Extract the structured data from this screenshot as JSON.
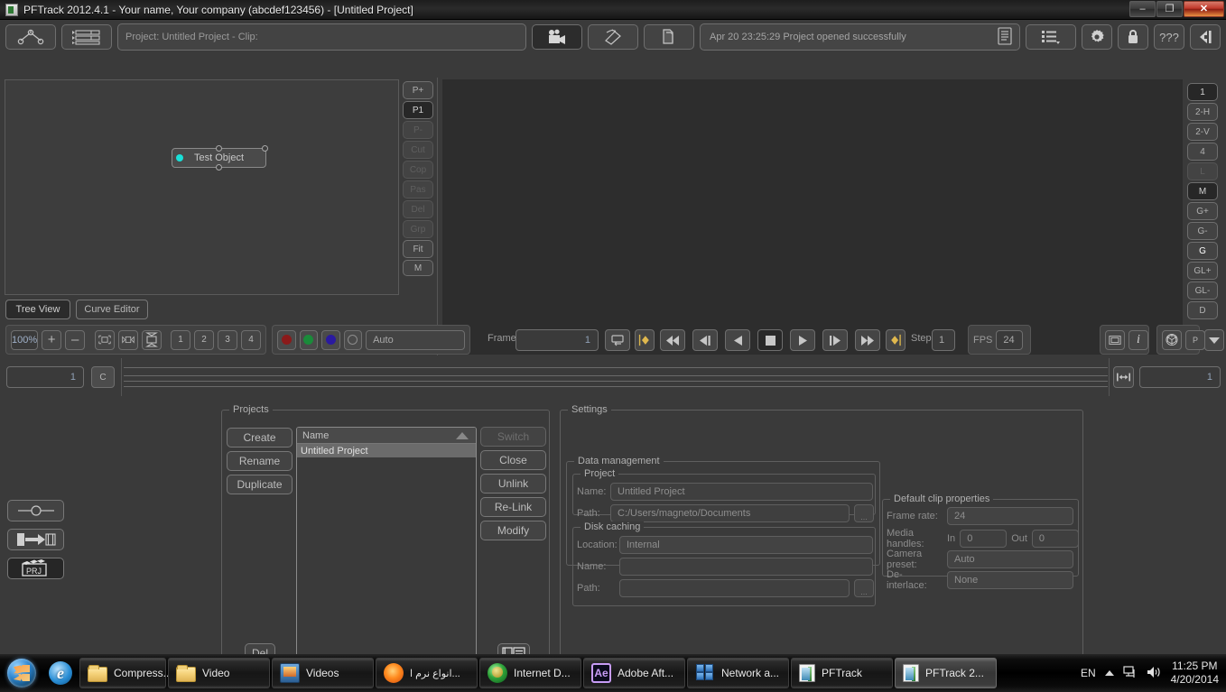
{
  "titlebar": {
    "title": "PFTrack 2012.4.1 - Your name, Your company (abcdef123456) - [Untitled Project]",
    "minimize": "–",
    "restore": "❐",
    "close": "✕"
  },
  "toolbar": {
    "project_field": "Project: Untitled Project - Clip:",
    "status_message": "Apr 20 23:25:29 Project opened successfully",
    "buttons": {
      "tree_icon": "node-tree-icon",
      "list_icon": "list-rows-icon",
      "camera_icon": "camera-icon",
      "film_icon": "film-clip-icon",
      "file_icon": "file-copy-icon",
      "log_icon": "log-text-icon",
      "menu_icon": "list-menu-icon",
      "gear_icon": "gear-icon",
      "lock_icon": "lock-icon",
      "help_label": "???",
      "exit_icon": "exit-icon"
    }
  },
  "node_editor": {
    "node_label": "Test Object",
    "left_tools": [
      "P+",
      "P1",
      "P-",
      "Cut",
      "Cop",
      "Pas",
      "Del",
      "Grp",
      "Fit",
      "M"
    ],
    "tabs": [
      {
        "label": "Tree View",
        "active": true
      },
      {
        "label": "Curve Editor",
        "active": false
      }
    ]
  },
  "clip_view": {
    "right_tools": [
      "1",
      "2-H",
      "2-V",
      "4",
      "L",
      "M",
      "G+",
      "G-",
      "G",
      "GL+",
      "GL-",
      "D"
    ]
  },
  "controls": {
    "zoom_value": "100%",
    "zoom_in": "+",
    "zoom_out": "–",
    "fit_icon": "fit-frame-icon",
    "fit_width_icon": "fit-width-icon",
    "fit_height_icon": "fit-height-icon",
    "view_numbers": [
      "1",
      "2",
      "3",
      "4"
    ],
    "channels": [
      "#8b1a1a",
      "#1a8b3a",
      "#2a1aa0"
    ],
    "channel_alpha_icon": "alpha-channel-icon",
    "lut_value": "Auto",
    "frame_label": "Frame",
    "frame_value": "1",
    "loop_icon": "loop-icon",
    "key_left_icon": "key-start-icon",
    "key_right_icon": "key-end-icon",
    "transport": [
      "rewind-all",
      "step-back-fast",
      "step-back",
      "stop",
      "play",
      "step-forward",
      "forward-all"
    ],
    "step_label": "Step",
    "step_value": "1",
    "fps_label": "FPS",
    "fps_value": "24",
    "monitor_icon": "film-strip-icon",
    "info_icon": "info-icon",
    "cube_icon": "3d-cube-icon",
    "p_icon": "P",
    "dropdown_icon": "chevron-down-icon"
  },
  "timeline": {
    "in_value": "1",
    "c_button": "C",
    "range_icon": "range-fit-icon",
    "out_value": "1"
  },
  "left_icons": {
    "slider_icon": "slider-icon",
    "import_icon": "import-clip-icon",
    "project_icon": "PRJ"
  },
  "projects_panel": {
    "title": "Projects",
    "left_buttons": [
      "Create",
      "Rename",
      "Duplicate"
    ],
    "delete_button": "Del",
    "list_header": "Name",
    "list_items": [
      "Untitled Project"
    ],
    "right_buttons": [
      {
        "label": "Switch",
        "enabled": false
      },
      {
        "label": "Close",
        "enabled": true
      },
      {
        "label": "Unlink",
        "enabled": true
      },
      {
        "label": "Re-Link",
        "enabled": true
      },
      {
        "label": "Modify",
        "enabled": true
      }
    ],
    "browse_icon": "media-browser-icon"
  },
  "settings_panel": {
    "title": "Settings",
    "data_management": {
      "title": "Data management",
      "project": {
        "title": "Project",
        "name_label": "Name:",
        "name_value": "Untitled Project",
        "path_label": "Path:",
        "path_value": "C:/Users/magneto/Documents",
        "browse_label": "..."
      },
      "disk_caching": {
        "title": "Disk caching",
        "location_label": "Location:",
        "location_value": "Internal",
        "name_label": "Name:",
        "name_value": "",
        "path_label": "Path:",
        "path_value": "",
        "browse_label": "..."
      }
    },
    "default_clip_properties": {
      "title": "Default clip properties",
      "frame_rate_label": "Frame rate:",
      "frame_rate_value": "24",
      "media_handles_label": "Media handles:",
      "in_label": "In",
      "in_value": "0",
      "out_label": "Out",
      "out_value": "0",
      "camera_preset_label": "Camera preset:",
      "camera_preset_value": "Auto",
      "deinterlace_label": "De-interlace:",
      "deinterlace_value": "None"
    }
  },
  "taskbar": {
    "start_label": "Start",
    "quick_launch": [
      "internet-explorer-icon"
    ],
    "items": [
      {
        "label": "Compress...",
        "icon": "folder-icon",
        "active": false
      },
      {
        "label": "Video",
        "icon": "folder-icon",
        "active": false
      },
      {
        "label": "Videos",
        "icon": "video-icon",
        "active": false
      },
      {
        "label": "انواع نرم ا...",
        "icon": "firefox-icon",
        "active": false
      },
      {
        "label": "Internet D...",
        "icon": "idm-icon",
        "active": false
      },
      {
        "label": "Adobe Aft...",
        "icon": "after-effects-icon",
        "active": false
      },
      {
        "label": "Network a...",
        "icon": "network-icon",
        "active": false
      },
      {
        "label": "PFTrack",
        "icon": "pftrack-icon",
        "active": false
      },
      {
        "label": "PFTrack 2...",
        "icon": "pftrack-icon",
        "active": true
      }
    ],
    "tray": {
      "language": "EN",
      "show_hidden_icon": "show-hidden-icons-icon",
      "network_icon": "network-tray-icon",
      "volume_icon": "volume-icon",
      "time": "11:25 PM",
      "date": "4/20/2014"
    }
  }
}
